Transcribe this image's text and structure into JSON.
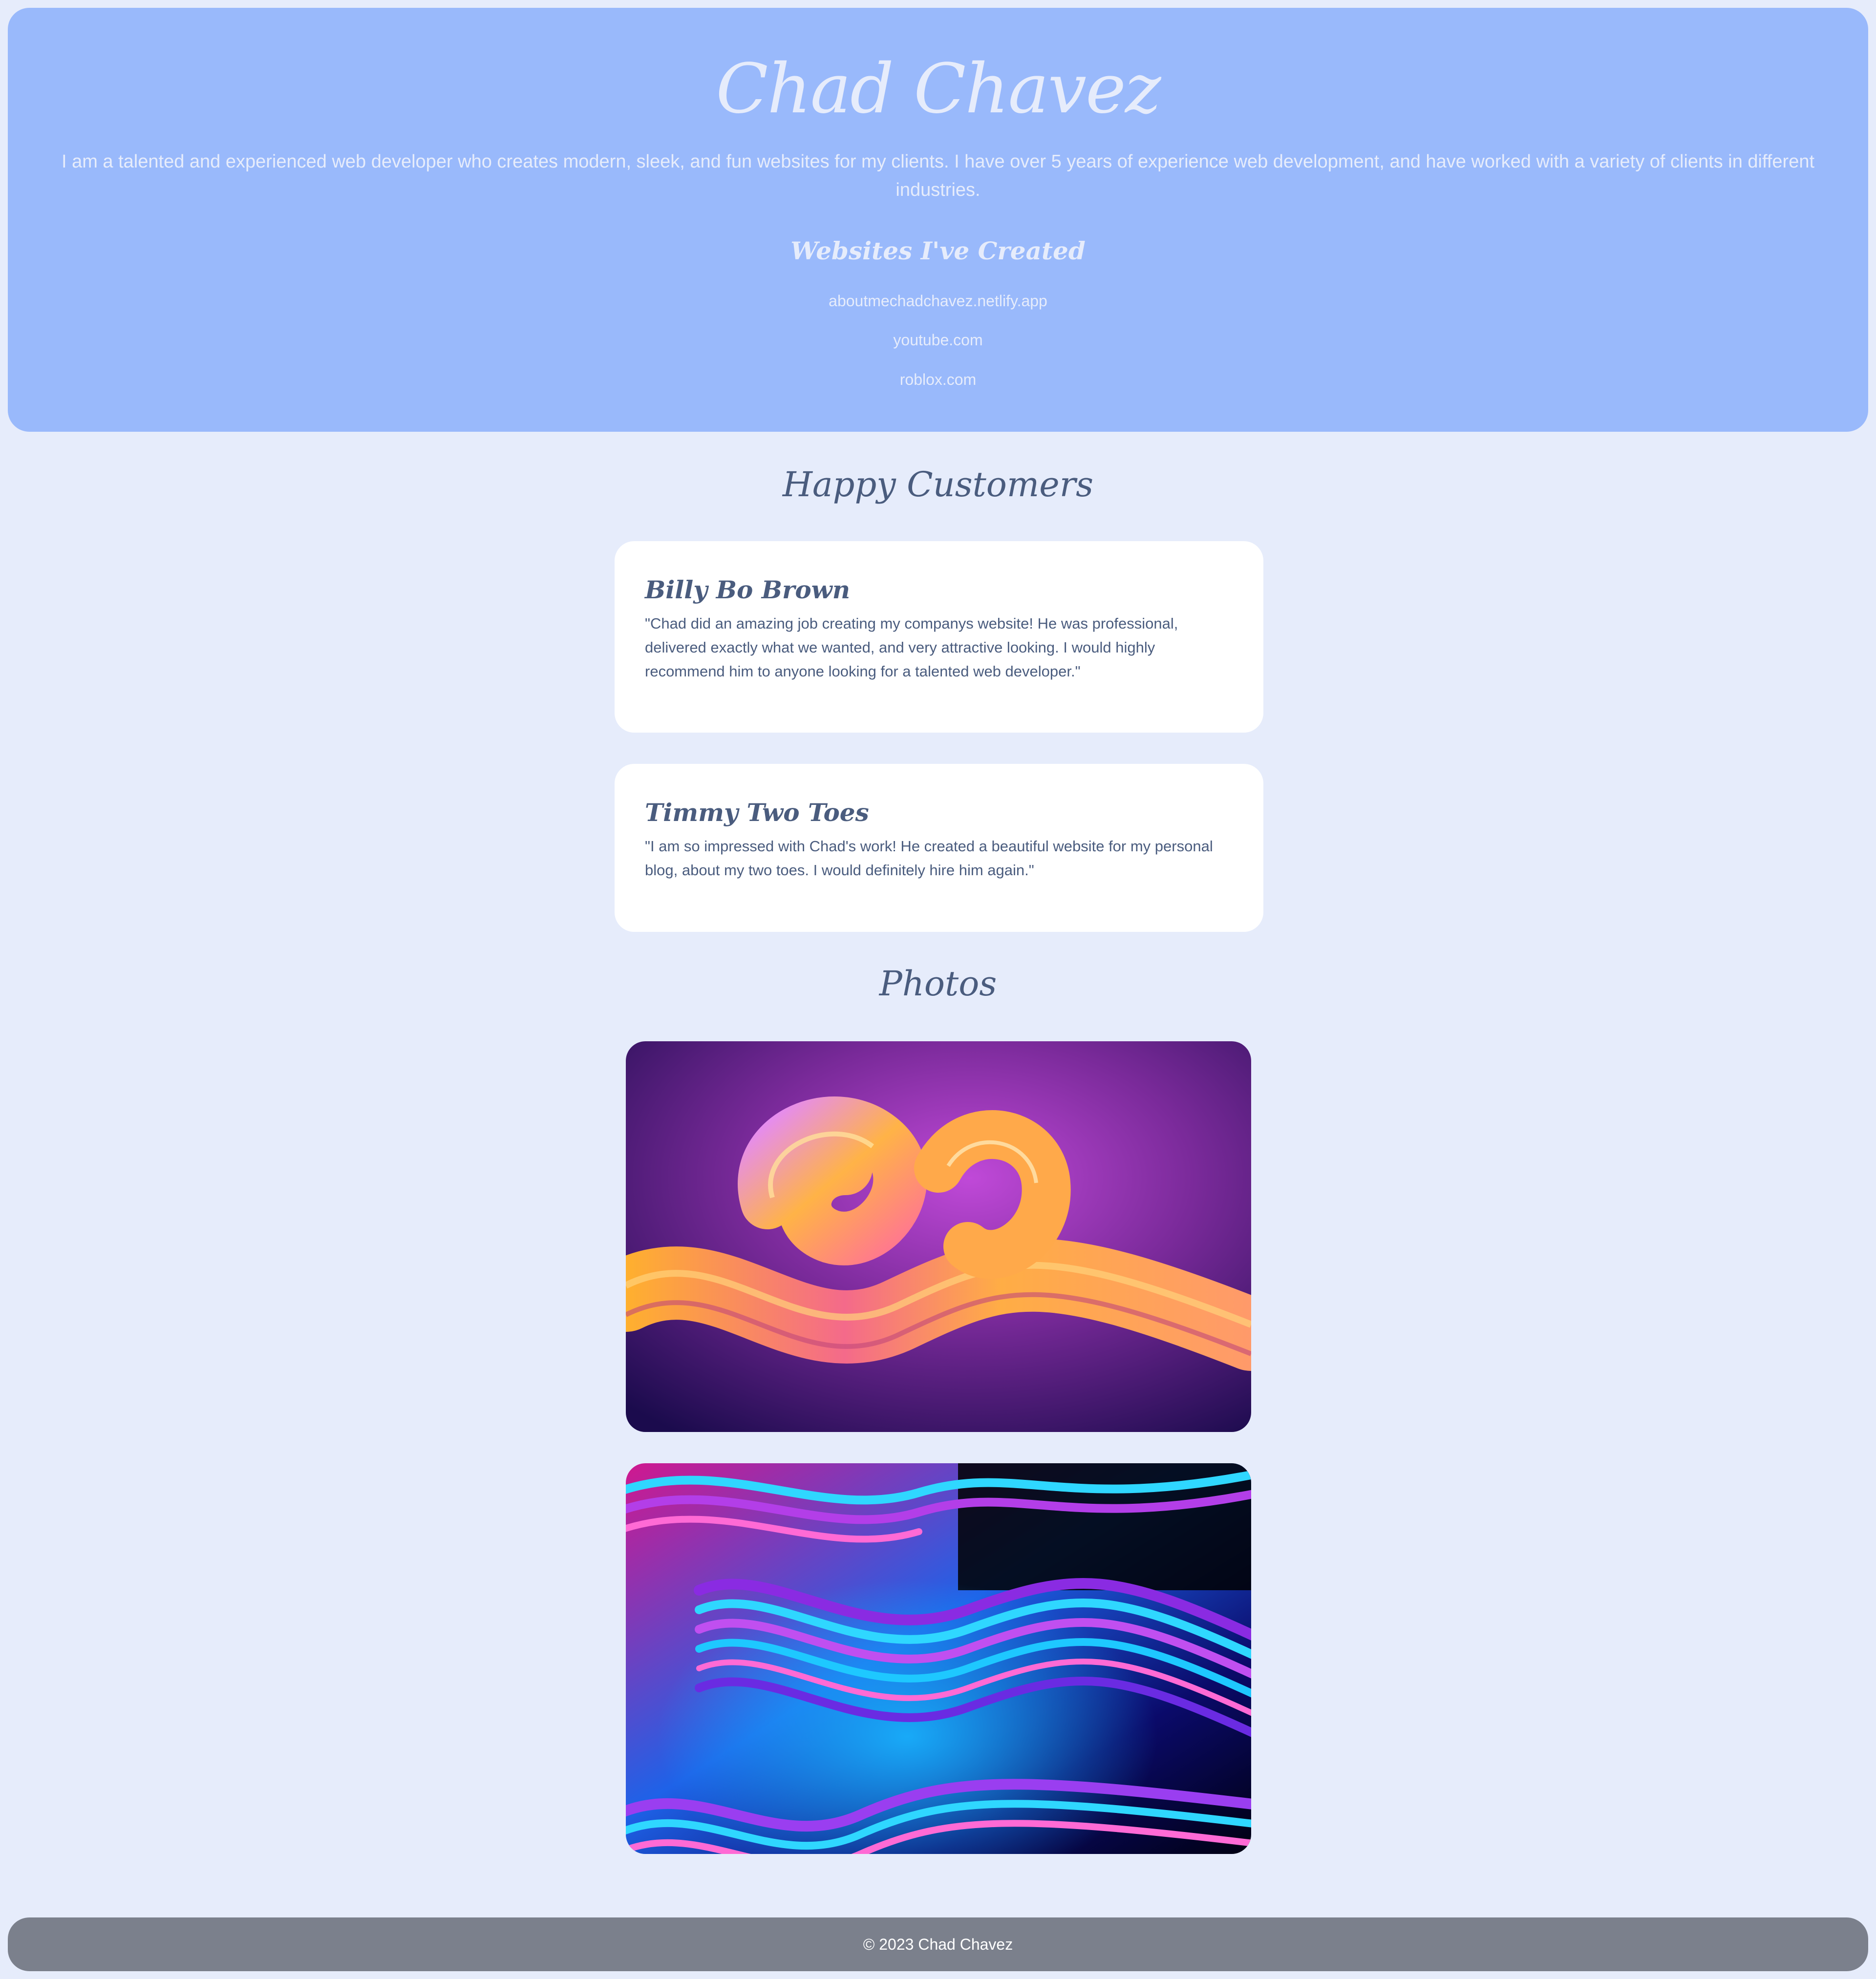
{
  "header": {
    "name": "Chad Chavez",
    "intro": "I am a talented and experienced web developer who creates modern, sleek, and fun websites for my clients. I have over 5 years of experience web development, and have worked with a variety of clients in different industries.",
    "websites_title": "Websites I've Created",
    "websites": [
      "aboutmechadchavez.netlify.app",
      "youtube.com",
      "roblox.com"
    ]
  },
  "testimonials": {
    "title": "Happy Customers",
    "items": [
      {
        "name": "Billy Bo Brown",
        "quote": "\"Chad did an amazing job creating my companys website! He was professional, delivered exactly what we wanted, and very attractive looking. I would highly recommend him to anyone looking for a talented web developer.\""
      },
      {
        "name": "Timmy Two Toes",
        "quote": "\"I am so impressed with Chad's work! He created a beautiful website for my personal blog, about my two toes. I would definitely hire him again.\""
      }
    ]
  },
  "photos": {
    "title": "Photos"
  },
  "footer": {
    "text": "© 2023 Chad Chavez"
  },
  "colors": {
    "page_background": "#e6ecfb",
    "header_background": "#99b9fb",
    "header_text": "#e6ecfb",
    "body_text": "#4a5c7e",
    "card_background": "#ffffff",
    "footer_background": "#7b808c"
  }
}
